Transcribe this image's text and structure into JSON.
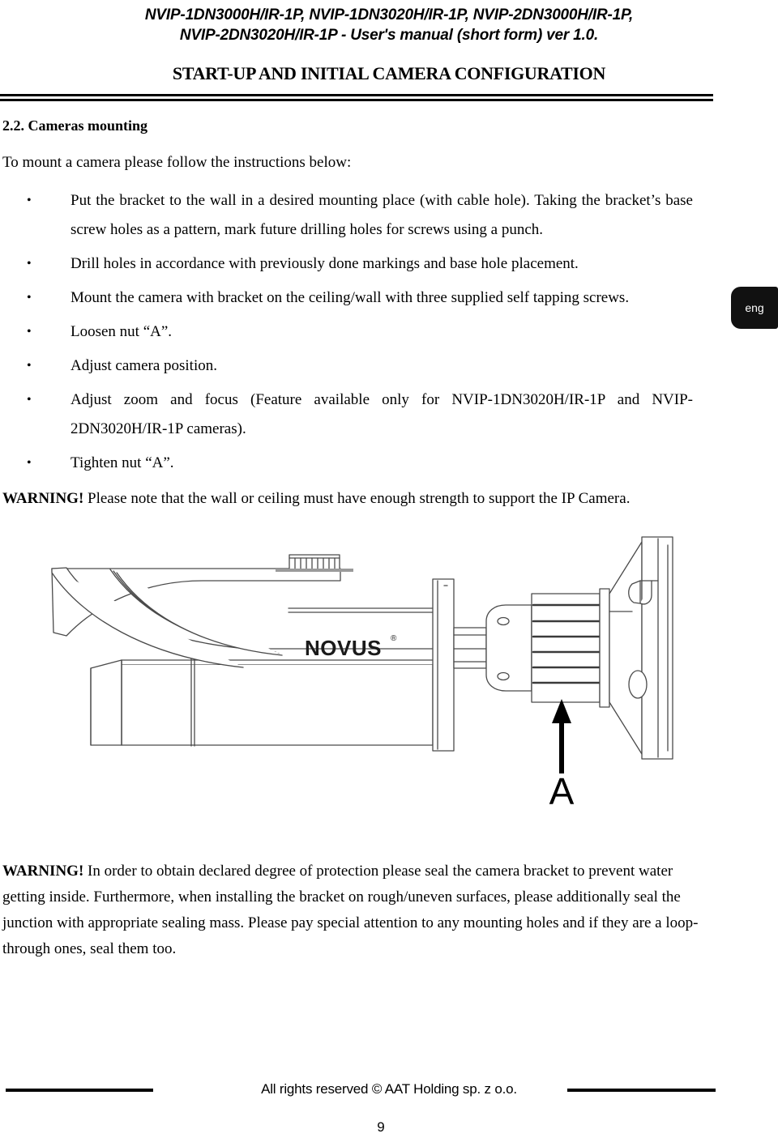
{
  "header": {
    "doc_title_line1": "NVIP-1DN3000H/IR-1P, NVIP-1DN3020H/IR-1P, NVIP-2DN3000H/IR-1P,",
    "doc_title_line2": "NVIP-2DN3020H/IR-1P - User's manual (short form) ver 1.0.",
    "section_banner": "START-UP AND INITIAL CAMERA CONFIGURATION"
  },
  "lang_tab": {
    "label": "eng"
  },
  "main": {
    "section_heading": "2.2. Cameras mounting",
    "intro": "To mount a camera please follow the instructions below:",
    "steps": [
      "Put the bracket to the wall in a desired mounting place (with cable hole). Taking the bracket’s base screw holes as a pattern, mark future drilling holes for screws using a punch.",
      "Drill holes in accordance with previously done markings and base hole placement.",
      "Mount the camera with bracket on the ceiling/wall with three supplied self tapping screws.",
      "Loosen nut “A”.",
      "Adjust camera position.",
      "Adjust zoom and focus (Feature available only for NVIP-1DN3020H/IR-1P and NVIP-2DN3020H/IR-1P cameras).",
      "Tighten nut “A”."
    ],
    "warning_top_label": "WARNING!",
    "warning_top_text": " Please note that the wall or ceiling must have enough strength to support the IP Camera.",
    "warning_bottom_label": "WARNING!",
    "warning_bottom_text": " In order to obtain declared degree of protection please seal the camera bracket to prevent water getting inside. Furthermore, when installing the bracket on rough/uneven surfaces, please additionally seal the junction with appropriate sealing mass. Please pay special attention to any mounting holes and if they are a loop-through ones, seal them too."
  },
  "figure": {
    "brand_logo_text": "NOVUS",
    "brand_logo_mark": "®",
    "callout_label": "A",
    "line_color": "#4a4a4a",
    "fill_color": "#ffffff"
  },
  "footer": {
    "copyright": "All rights reserved © AAT Holding sp. z o.o.",
    "page_number": "9"
  }
}
